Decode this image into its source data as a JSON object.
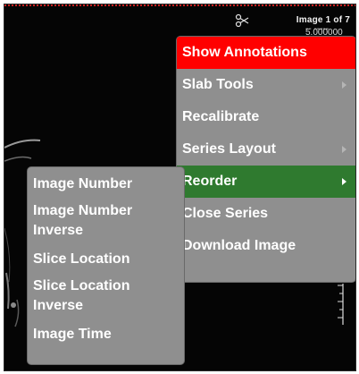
{
  "viewer": {
    "image_counter": "Image 1 of 7",
    "overlay_partial": "-- ----- 5.000000"
  },
  "context_menu": {
    "items": [
      {
        "label": "Show Annotations",
        "submenu": false
      },
      {
        "label": "Slab Tools",
        "submenu": true
      },
      {
        "label": "Recalibrate",
        "submenu": false
      },
      {
        "label": "Series Layout",
        "submenu": true
      },
      {
        "label": "Reorder",
        "submenu": true
      },
      {
        "label": "Close Series",
        "submenu": false
      },
      {
        "label": "Download Image",
        "submenu": false
      }
    ],
    "active_item": "Reorder",
    "hovered_item": "Show Annotations"
  },
  "reorder_submenu": {
    "items": [
      {
        "label": "Image Number"
      },
      {
        "label": "Image Number\nInverse"
      },
      {
        "label": "Slice Location"
      },
      {
        "label": "Slice Location\nInverse"
      },
      {
        "label": "Image Time"
      }
    ]
  },
  "colors": {
    "menu_background": "#8f8f8f",
    "hover_red": "#ff0000",
    "active_green": "#2f7a2f",
    "viewer_background": "#050505"
  },
  "icons": {
    "submenu_arrow": "chevron-right-icon",
    "tool_cursor": "scissors-icon"
  }
}
